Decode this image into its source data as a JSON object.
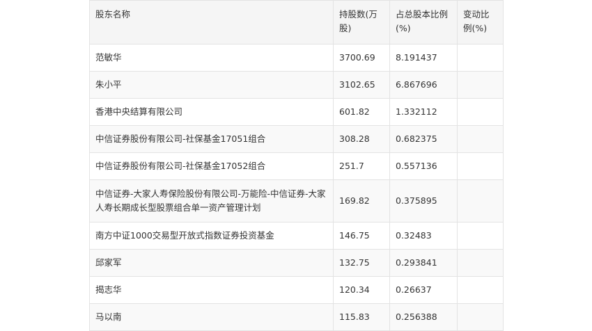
{
  "table": {
    "headers": [
      "股东名称",
      "持股数(万股)",
      "占总股本比例(%)",
      "变动比例(%)"
    ],
    "rows": [
      {
        "name": "范敏华",
        "shares": "3700.69",
        "ratio": "8.191437",
        "change": ""
      },
      {
        "name": "朱小平",
        "shares": "3102.65",
        "ratio": "6.867696",
        "change": ""
      },
      {
        "name": "香港中央结算有限公司",
        "shares": "601.82",
        "ratio": "1.332112",
        "change": ""
      },
      {
        "name": "中信证券股份有限公司-社保基金17051组合",
        "shares": "308.28",
        "ratio": "0.682375",
        "change": ""
      },
      {
        "name": "中信证券股份有限公司-社保基金17052组合",
        "shares": "251.7",
        "ratio": "0.557136",
        "change": ""
      },
      {
        "name": "中信证券-大家人寿保险股份有限公司-万能险-中信证券-大家人寿长期成长型股票组合单一资产管理计划",
        "shares": "169.82",
        "ratio": "0.375895",
        "change": ""
      },
      {
        "name": "南方中证1000交易型开放式指数证券投资基金",
        "shares": "146.75",
        "ratio": "0.32483",
        "change": ""
      },
      {
        "name": "邱家军",
        "shares": "132.75",
        "ratio": "0.293841",
        "change": ""
      },
      {
        "name": "揭志华",
        "shares": "120.34",
        "ratio": "0.26637",
        "change": ""
      },
      {
        "name": "马以南",
        "shares": "115.83",
        "ratio": "0.256388",
        "change": ""
      }
    ]
  }
}
